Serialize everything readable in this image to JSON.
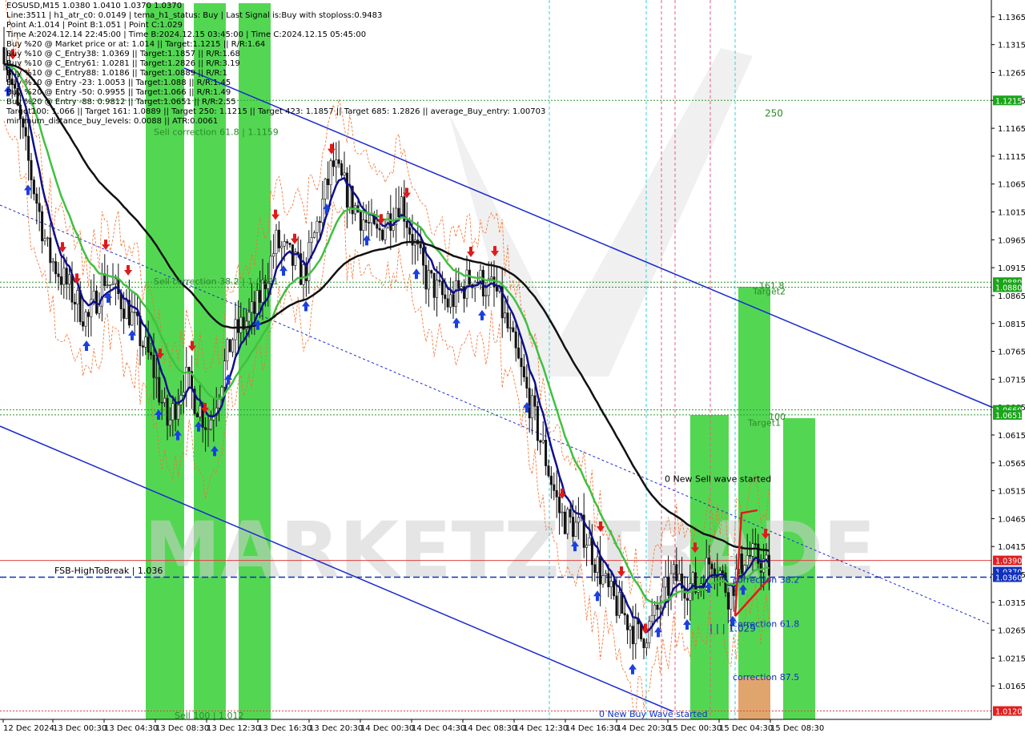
{
  "header": {
    "lines": [
      "EOSUSD,M15  1.0380 1.0410 1.0370 1.0370",
      "Line:3511 | h1_atr_c0: 0.0149 | tema_h1_status: Buy | Last Signal is:Buy with stoploss:0.9483",
      "Point A:1.014 | Point B:1.051 | Point C:1.029",
      "Time A:2024.12.14 22:45:00 | Time B:2024.12.15 03:45:00 | Time C:2024.12.15 05:45:00",
      "Buy %20 @ Market price or at: 1.014 || Target:1.1215 || R/R:1.64",
      "Buy %10 @ C_Entry38: 1.0369 || Target:1.1857 || R/R:1.68",
      "Buy %10 @ C_Entry61: 1.0281 || Target:1.2826 || R/R:3.19",
      "Buy %10 @ C_Entry88: 1.0186 || Target:1.0889 || R/R:1",
      "Buy %10 @ Entry -23: 1.0053 || Target:1.088 || R/R:1.45",
      "Buy %20 @ Entry -50: 0.9955 || Target:1.066 || R/R:1.49",
      "Buy %20 @ Entry -88: 0.9812 || Target:1.0651 || R/R:2.55",
      "Target100: 1.066 || Target 161: 1.0889 || Target 250: 1.1215 || Target 423: 1.1857 || Target 685: 1.2826 || average_Buy_entry: 1.00703",
      "minimum_distance_buy_levels: 0.0088 || ATR:0.0061"
    ]
  },
  "chart_data": {
    "type": "candlestick",
    "symbol": "EOSUSD",
    "timeframe": "M15",
    "ohlc_current": {
      "open": 1.038,
      "high": 1.041,
      "low": 1.037,
      "close": 1.037
    },
    "ylim": [
      1.0105,
      1.1395
    ],
    "y_ticks": [
      "1.1365",
      "1.1315",
      "1.1265",
      "1.1215",
      "1.1165",
      "1.1115",
      "1.1065",
      "1.1015",
      "1.0965",
      "1.0915",
      "1.0865",
      "1.0815",
      "1.0765",
      "1.0715",
      "1.0665",
      "1.0615",
      "1.0565",
      "1.0515",
      "1.0465",
      "1.0415",
      "1.0365",
      "1.0315",
      "1.0265",
      "1.0215",
      "1.0165"
    ],
    "x_ticks": [
      "12 Dec 2024",
      "13 Dec 00:30",
      "13 Dec 04:30",
      "13 Dec 08:30",
      "13 Dec 12:30",
      "13 Dec 16:30",
      "13 Dec 20:30",
      "14 Dec 00:30",
      "14 Dec 04:30",
      "14 Dec 08:30",
      "14 Dec 12:30",
      "14 Dec 16:30",
      "14 Dec 20:30",
      "15 Dec 00:30",
      "15 Dec 04:30",
      "15 Dec 08:30"
    ],
    "price_badges": [
      {
        "value": "1.1215",
        "color": "#1aa51a"
      },
      {
        "value": "1.0889",
        "color": "#1aa51a"
      },
      {
        "value": "1.0880",
        "color": "#1aa51a"
      },
      {
        "value": "1.0660",
        "color": "#1aa51a"
      },
      {
        "value": "1.0651",
        "color": "#1aa51a"
      },
      {
        "value": "1.0390",
        "color": "#e02020"
      },
      {
        "value": "1.0370",
        "color": "#1030c0"
      },
      {
        "value": "1.0360",
        "color": "#1030c0"
      },
      {
        "value": "1.0120",
        "color": "#e02020"
      }
    ],
    "horizontal_levels": [
      {
        "price": 1.1215,
        "style": "dotted",
        "color": "#2a9a2a"
      },
      {
        "price": 1.0889,
        "style": "dotted",
        "color": "#2a9a2a"
      },
      {
        "price": 1.088,
        "style": "dotted",
        "color": "#2a9a2a"
      },
      {
        "price": 1.066,
        "style": "dotted",
        "color": "#2a9a2a"
      },
      {
        "price": 1.0651,
        "style": "dotted",
        "color": "#2a9a2a"
      },
      {
        "price": 1.039,
        "style": "solid",
        "color": "#e04040"
      },
      {
        "price": 1.036,
        "style": "dashed",
        "color": "#1030c0"
      },
      {
        "price": 1.012,
        "style": "dotted",
        "color": "#e04040"
      }
    ],
    "annotations": [
      {
        "text": "Sell correction 61.8 | 1.1159",
        "price": 1.1159,
        "color": "#2a8a2a"
      },
      {
        "text": "Sell correction 38.2 | 1.0891",
        "price": 1.0891,
        "color": "#2a8a2a"
      },
      {
        "text": "250",
        "price": 1.1192,
        "color": "#2a8a2a"
      },
      {
        "text": "161.8",
        "price": 1.0883,
        "color": "#2a8a2a"
      },
      {
        "text": "Target2",
        "price": 1.0873,
        "color": "#2a8a2a"
      },
      {
        "text": "100",
        "price": 1.0648,
        "color": "#2a8a2a"
      },
      {
        "text": "Target1",
        "price": 1.0637,
        "color": "#2a8a2a"
      },
      {
        "text": "0 New Sell wave started",
        "price": 1.0537,
        "color": "#000000"
      },
      {
        "text": "FSB-HighToBreak | 1.036",
        "price": 1.0372,
        "color": "#000000"
      },
      {
        "text": "correction 38.2",
        "price": 1.0356,
        "color": "#1030c0"
      },
      {
        "text": "correction 61.8",
        "price": 1.0277,
        "color": "#1030c0"
      },
      {
        "text": "| | | 1.029",
        "price": 1.0268,
        "color": "#1030c0"
      },
      {
        "text": "correction 87.5",
        "price": 1.0181,
        "color": "#1030c0"
      },
      {
        "text": "0 New Buy Wave started",
        "price": 1.0115,
        "color": "#1030c0"
      },
      {
        "text": "Sell 100 | 1.012",
        "price": 1.0112,
        "color": "#2a8a2a"
      }
    ],
    "watermark": "MARKETZITRADE"
  }
}
